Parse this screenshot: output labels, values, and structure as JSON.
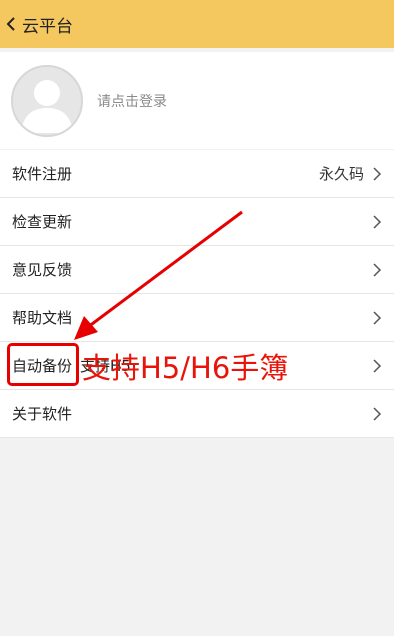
{
  "header": {
    "title": "云平台",
    "back_icon": "chevron-left-icon",
    "background": "#f4c85f"
  },
  "profile": {
    "login_text": "请点击登录",
    "avatar_icon": "user-avatar-icon"
  },
  "menu": {
    "items": [
      {
        "label": "软件注册",
        "value": "永久码"
      },
      {
        "label": "检查更新"
      },
      {
        "label": "意见反馈"
      },
      {
        "label": "帮助文档"
      },
      {
        "label": "自动备份",
        "value": "支持H5"
      },
      {
        "label": "关于软件"
      }
    ]
  },
  "annotation": {
    "text": "支持H5/H6手簿",
    "color": "#e8140a"
  }
}
